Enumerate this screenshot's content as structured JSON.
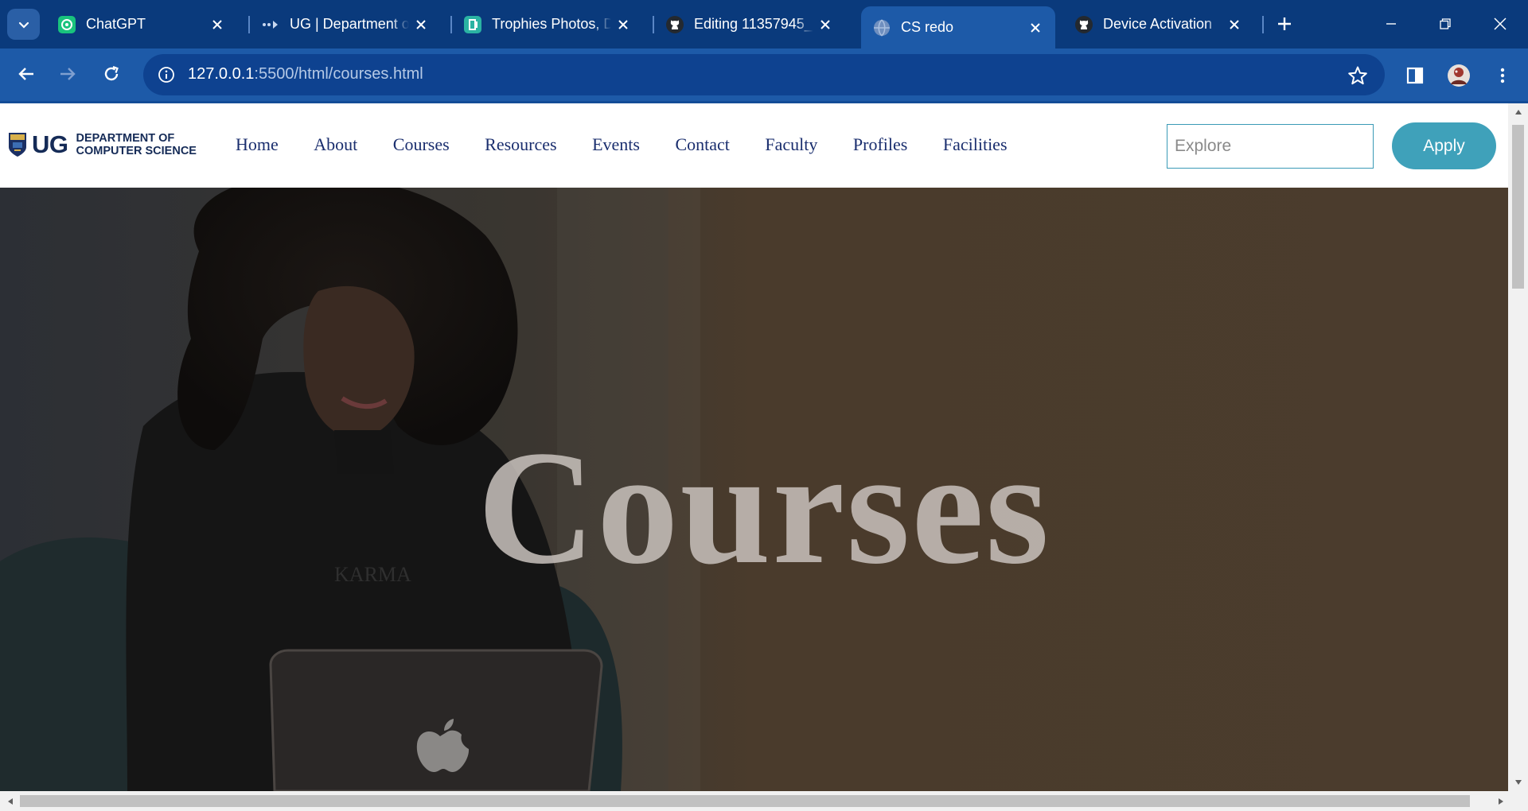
{
  "browser": {
    "tabs": [
      {
        "title": "ChatGPT",
        "icon": "chatgpt-icon"
      },
      {
        "title": "UG | Department of",
        "icon": "ug-favicon-icon"
      },
      {
        "title": "Trophies Photos, D",
        "icon": "trophies-favicon-icon"
      },
      {
        "title": "Editing 11357945_",
        "icon": "github-icon"
      },
      {
        "title": "CS redo",
        "icon": "globe-icon",
        "active": true
      },
      {
        "title": "Device Activation",
        "icon": "github-icon"
      }
    ],
    "url_host": "127.0.0.1",
    "url_rest": ":5500/html/courses.html",
    "colors": {
      "frame": "#0a3a7c",
      "toolbar": "#1d5aa8",
      "omnibox": "#0e4290"
    }
  },
  "site": {
    "logo": {
      "short": "UG",
      "line1": "DEPARTMENT OF",
      "line2": "COMPUTER SCIENCE"
    },
    "nav": [
      "Home",
      "About",
      "Courses",
      "Resources",
      "Events",
      "Contact",
      "Faculty",
      "Profiles",
      "Facilities"
    ],
    "search_placeholder": "Explore",
    "apply_label": "Apply",
    "colors": {
      "nav_text": "#1a2e6e",
      "apply_bg": "#3fa1ba",
      "search_border": "#3a9ab6"
    }
  },
  "hero": {
    "title": "Courses",
    "colors": {
      "overlay": "#4a3b2c"
    }
  }
}
